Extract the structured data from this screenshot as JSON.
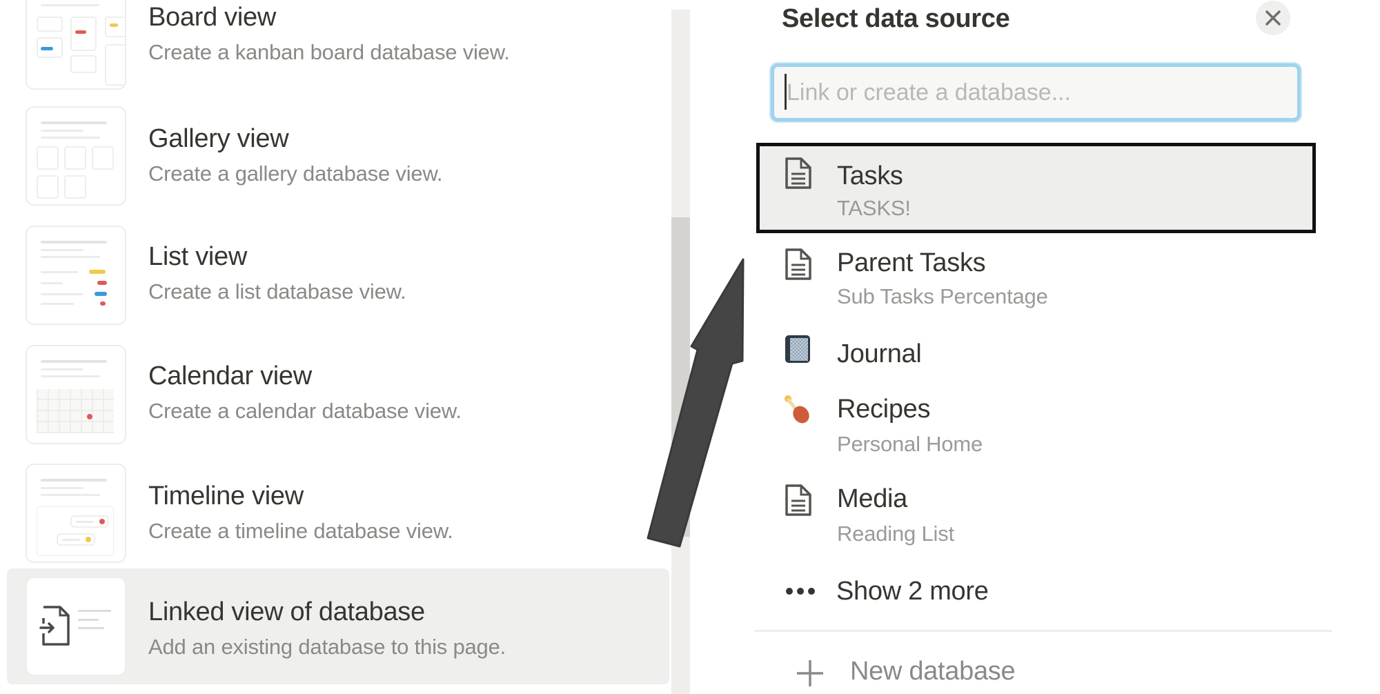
{
  "left_panel": {
    "views": [
      {
        "title": "Board view",
        "description": "Create a kanban board database view.",
        "icon": "board-view-thumbnail"
      },
      {
        "title": "Gallery view",
        "description": "Create a gallery database view.",
        "icon": "gallery-view-thumbnail"
      },
      {
        "title": "List view",
        "description": "Create a list database view.",
        "icon": "list-view-thumbnail"
      },
      {
        "title": "Calendar view",
        "description": "Create a calendar database view.",
        "icon": "calendar-view-thumbnail"
      },
      {
        "title": "Timeline view",
        "description": "Create a timeline database view.",
        "icon": "timeline-view-thumbnail"
      },
      {
        "title": "Linked view of database",
        "description": "Add an existing database to this page.",
        "icon": "linked-database-icon",
        "highlighted": true
      }
    ]
  },
  "right_panel": {
    "title": "Select data source",
    "close_icon": "close-icon",
    "search": {
      "placeholder": "Link or create a database...",
      "value": ""
    },
    "sources": [
      {
        "title": "Tasks",
        "subtitle": "TASKS!",
        "icon": "page-icon",
        "selected": true
      },
      {
        "title": "Parent Tasks",
        "subtitle": "Sub Tasks Percentage",
        "icon": "page-icon"
      },
      {
        "title": "Journal",
        "subtitle": "",
        "icon": "notebook-icon"
      },
      {
        "title": "Recipes",
        "subtitle": "Personal Home",
        "icon": "poultry-leg-icon"
      },
      {
        "title": "Media",
        "subtitle": "Reading List",
        "icon": "page-icon"
      }
    ],
    "show_more_label": "Show 2 more",
    "new_database_label": "New database"
  },
  "colors": {
    "focus_ring": "#9fd3ee",
    "highlight_bg": "#efefee",
    "selected_border": "#111111",
    "annotation_arrow": "#454545",
    "red_tag": "#e05a5a",
    "yellow_tag": "#f1c94a",
    "blue_tag": "#3a9ad9"
  }
}
